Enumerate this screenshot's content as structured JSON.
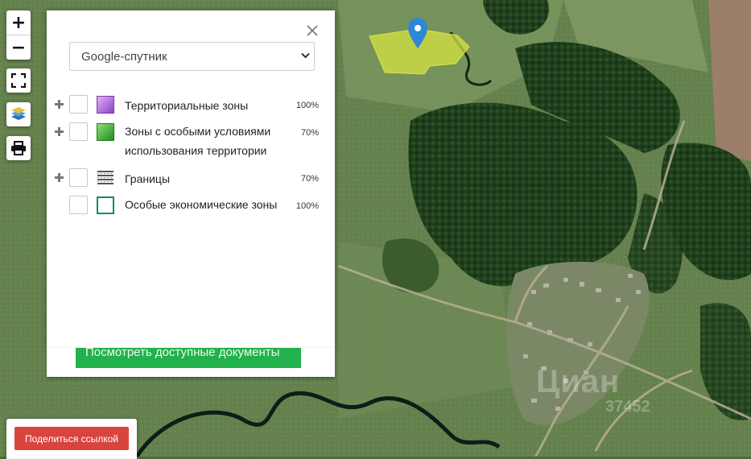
{
  "map": {
    "controls": {
      "zoom_in_glyph": "+",
      "zoom_out_glyph": "−",
      "fullscreen_icon": "fullscreen-icon",
      "layers_icon": "layers-icon",
      "print_icon": "printer-icon"
    },
    "colors": {
      "parcel_fill": "#d8e640",
      "marker": "#2f86d6"
    }
  },
  "layers_panel": {
    "basemap_selected": "Google-спутник",
    "layers": [
      {
        "name": "Территориальные зоны",
        "opacity": "100%",
        "expandable": true,
        "swatch": "purple-gradient",
        "checked": false
      },
      {
        "name": "Зоны с особыми условиями использования территории",
        "opacity": "70%",
        "expandable": true,
        "swatch": "green-gradient",
        "checked": false
      },
      {
        "name": "Границы",
        "opacity": "70%",
        "expandable": true,
        "swatch": "gray-stripes",
        "checked": false
      },
      {
        "name": "Особые экономические зоны",
        "opacity": "100%",
        "expandable": false,
        "swatch": "green-outline",
        "checked": false
      }
    ],
    "docs_button_label": "Посмотреть доступные документы ⟶"
  },
  "share_button_label": "Поделиться ссылкой",
  "watermark": {
    "brand": "Циан",
    "id": "37452"
  }
}
